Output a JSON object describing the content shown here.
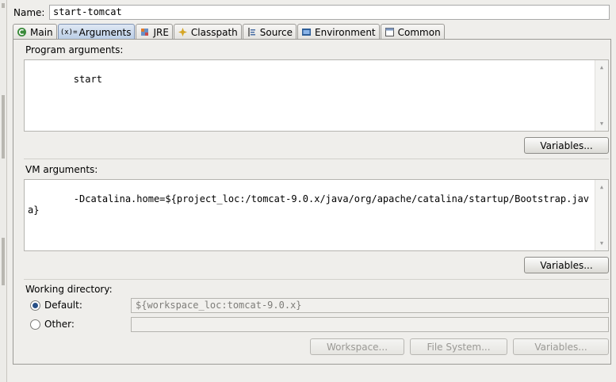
{
  "name_label": "Name:",
  "name_value": "start-tomcat",
  "tabs": [
    {
      "label": "Main",
      "icon": "main-tab-icon"
    },
    {
      "label": "Arguments",
      "icon": "arguments-tab-icon"
    },
    {
      "label": "JRE",
      "icon": "jre-tab-icon"
    },
    {
      "label": "Classpath",
      "icon": "classpath-tab-icon"
    },
    {
      "label": "Source",
      "icon": "source-tab-icon"
    },
    {
      "label": "Environment",
      "icon": "environment-tab-icon"
    },
    {
      "label": "Common",
      "icon": "common-tab-icon"
    }
  ],
  "active_tab": "Arguments",
  "program_arguments": {
    "label": "Program arguments:",
    "value": "start",
    "variables_button": "Variables..."
  },
  "vm_arguments": {
    "label": "VM arguments:",
    "value": "-Dcatalina.home=${project_loc:/tomcat-9.0.x/java/org/apache/catalina/startup/Bootstrap.java}",
    "variables_button": "Variables..."
  },
  "working_directory": {
    "label": "Working directory:",
    "default_label": "Default:",
    "default_value": "${workspace_loc:tomcat-9.0.x}",
    "other_label": "Other:",
    "other_value": "",
    "selected": "Default",
    "workspace_button": "Workspace...",
    "filesystem_button": "File System...",
    "variables_button": "Variables..."
  },
  "colors": {
    "active_tab": "#b9cde6",
    "panel_bg": "#efeeeb",
    "radio_dot": "#264e86"
  }
}
